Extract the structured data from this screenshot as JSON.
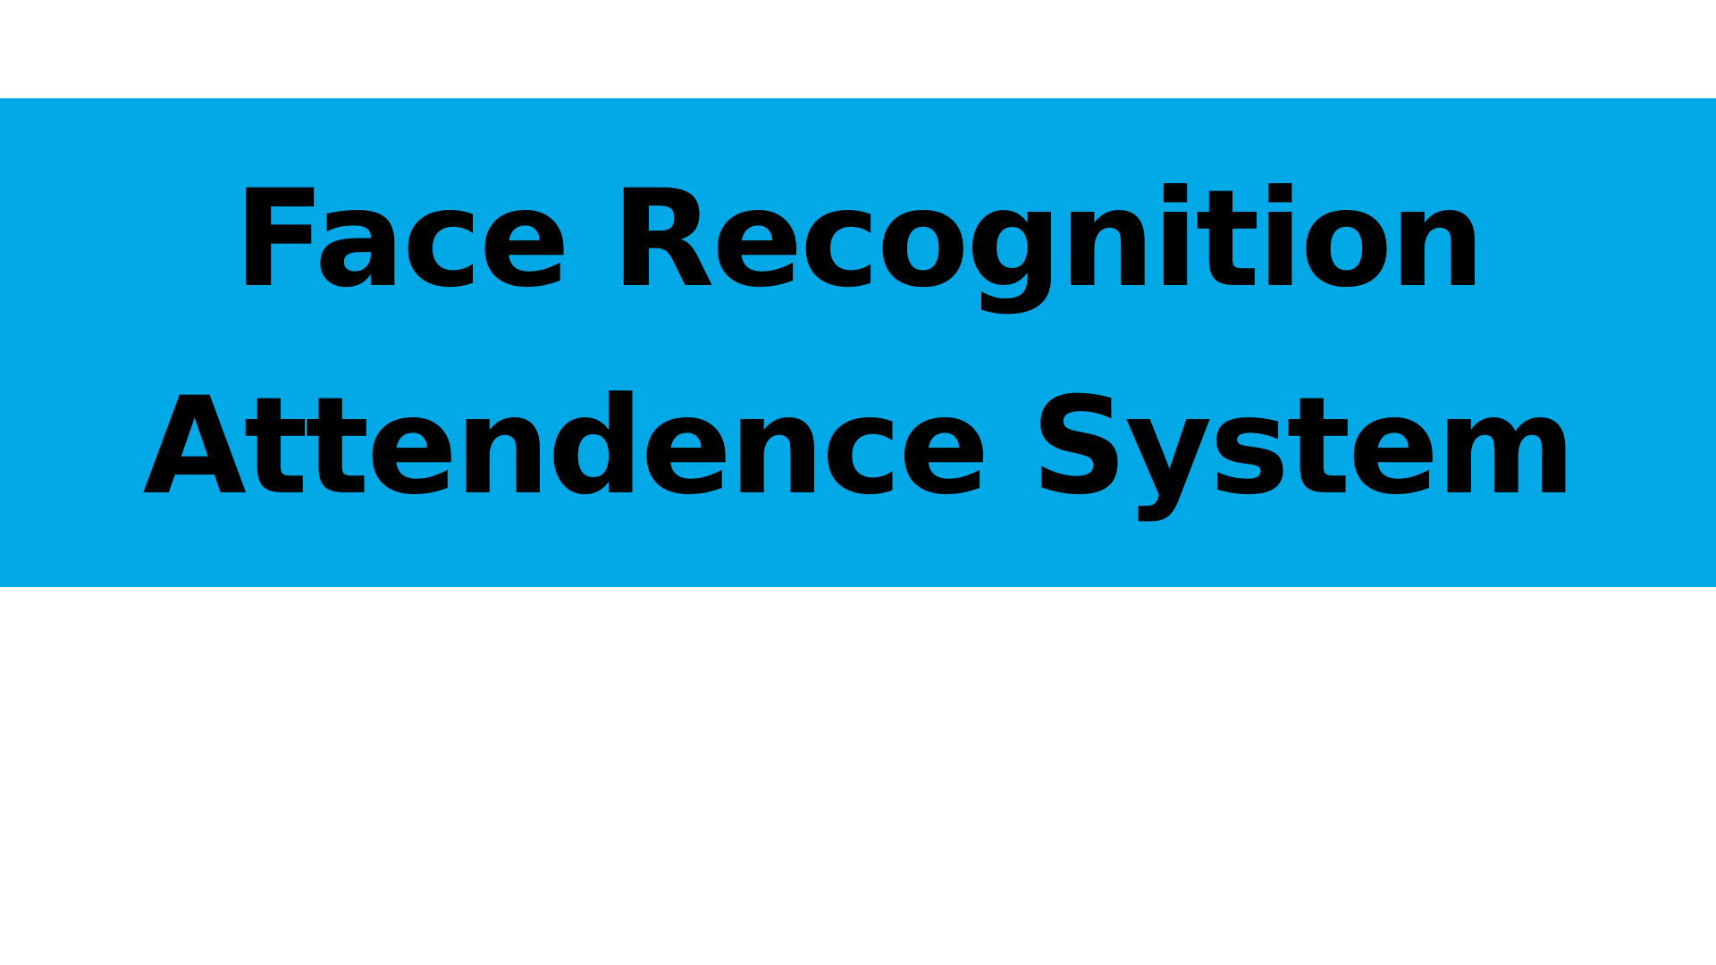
{
  "banner": {
    "background_color": "#03a9e6",
    "text_color": "#000000",
    "title_line_1": "Face Recognition",
    "title_line_2": "Attendence System"
  }
}
